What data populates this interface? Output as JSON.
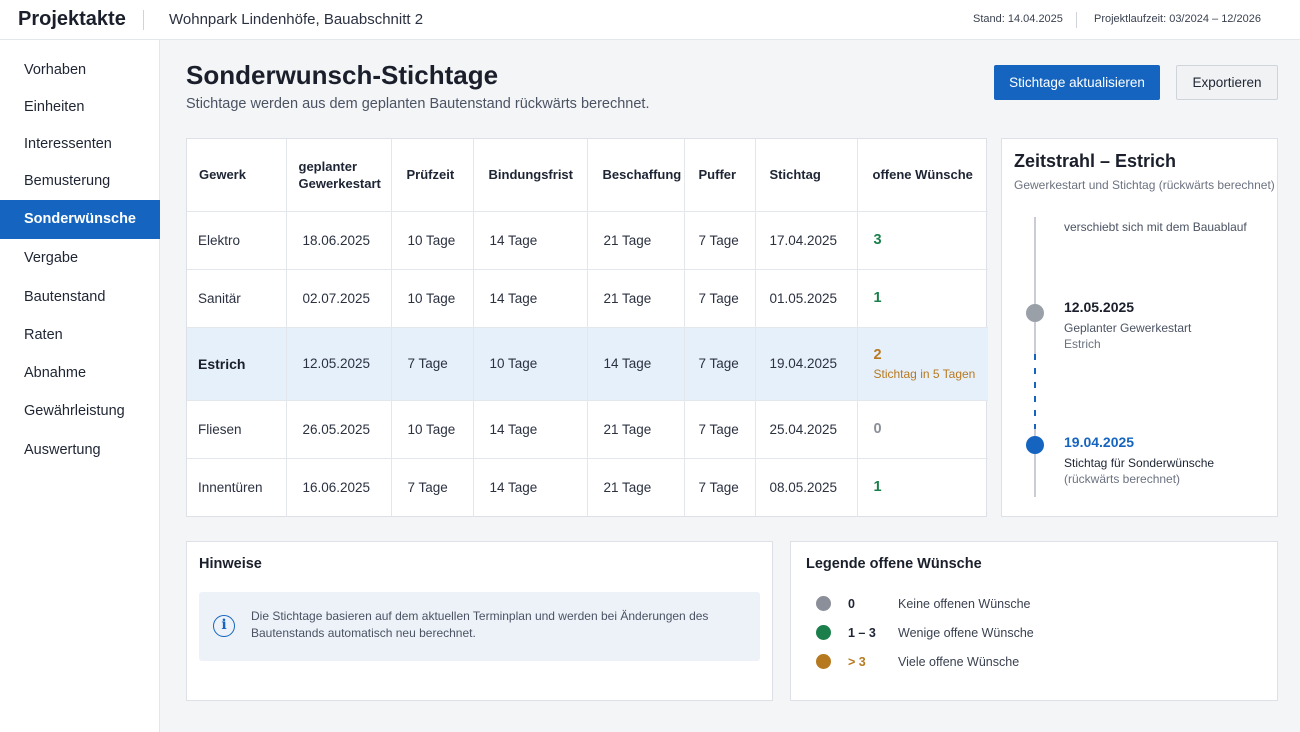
{
  "topbar": {
    "brand": "Projektakte",
    "project": "Wohnpark Lindenhöfe, Bauabschnitt 2",
    "stand": "Stand: 14.04.2025",
    "laufzeit": "Projektlaufzeit: 03/2024 – 12/2026"
  },
  "sidebar": {
    "items": [
      {
        "label": "Vorhaben"
      },
      {
        "label": "Einheiten"
      },
      {
        "label": "Interessenten"
      },
      {
        "label": "Bemusterung"
      },
      {
        "label": "Sonderwünsche",
        "active": true
      },
      {
        "label": "Vergabe"
      },
      {
        "label": "Bautenstand"
      },
      {
        "label": "Raten"
      },
      {
        "label": "Abnahme"
      },
      {
        "label": "Gewährleistung"
      },
      {
        "label": "Auswertung"
      }
    ]
  },
  "header": {
    "title": "Sonderwunsch-Stichtage",
    "subtitle": "Stichtage werden aus dem geplanten Bautenstand rückwärts berechnet.",
    "primary_button": "Stichtage aktualisieren",
    "secondary_button": "Exportieren"
  },
  "table": {
    "columns": [
      "Gewerk",
      "geplanter Gewerkestart",
      "Prüfzeit",
      "Bindungsfrist",
      "Beschaffung",
      "Puffer",
      "Stichtag",
      "offene Wünsche"
    ],
    "rows": [
      {
        "gewerk": "Elektro",
        "start": "18.06.2025",
        "pruefzeit": "10 Tage",
        "bindungsfrist": "14 Tage",
        "beschaffung": "21 Tage",
        "puffer": "7 Tage",
        "stichtag": "17.04.2025",
        "offen": "3"
      },
      {
        "gewerk": "Sanitär",
        "start": "02.07.2025",
        "pruefzeit": "10 Tage",
        "bindungsfrist": "14 Tage",
        "beschaffung": "21 Tage",
        "puffer": "7 Tage",
        "stichtag": "01.05.2025",
        "offen": "1"
      },
      {
        "gewerk": "Estrich",
        "start": "12.05.2025",
        "pruefzeit": "7 Tage",
        "bindungsfrist": "10 Tage",
        "beschaffung": "14 Tage",
        "puffer": "7 Tage",
        "stichtag": "19.04.2025",
        "offen": "2",
        "note": "Stichtag in 5 Tagen"
      },
      {
        "gewerk": "Fliesen",
        "start": "26.05.2025",
        "pruefzeit": "10 Tage",
        "bindungsfrist": "14 Tage",
        "beschaffung": "21 Tage",
        "puffer": "7 Tage",
        "stichtag": "25.04.2025",
        "offen": "0"
      },
      {
        "gewerk": "Innentüren",
        "start": "16.06.2025",
        "pruefzeit": "7 Tage",
        "bindungsfrist": "14 Tage",
        "beschaffung": "21 Tage",
        "puffer": "7 Tage",
        "stichtag": "08.05.2025",
        "offen": "1"
      }
    ]
  },
  "timeline": {
    "title": "Zeitstrahl – Estrich",
    "subtitle": "Gewerkestart und Stichtag (rückwärts berechnet)",
    "note": "verschiebt sich mit dem Bauablauf",
    "start_date": "12.05.2025",
    "start_label": "Geplanter Gewerkestart",
    "start_sublabel": "Estrich",
    "deadline_date": "19.04.2025",
    "deadline_label": "Stichtag für Sonderwünsche",
    "deadline_sublabel": "(rückwärts berechnet)"
  },
  "hints": {
    "title": "Hinweise",
    "icon": "info-icon",
    "text": "Die Stichtage basieren auf dem aktuellen Terminplan und werden bei Änderungen des Bautenstands automatisch neu berechnet."
  },
  "legend": {
    "title": "Legende offene Wünsche",
    "items": [
      {
        "range": "0",
        "label": "Keine offenen Wünsche",
        "color": "#8a8f99"
      },
      {
        "range": "1 – 3",
        "label": "Wenige offene Wünsche",
        "color": "#1a7f4b"
      },
      {
        "range": "> 3",
        "label": "Viele offene Wünsche",
        "color": "#b7791f"
      }
    ]
  },
  "colors": {
    "accent": "#1565c0",
    "green": "#1a7f4b",
    "orange": "#b7791f",
    "grey": "#8a8f99"
  }
}
